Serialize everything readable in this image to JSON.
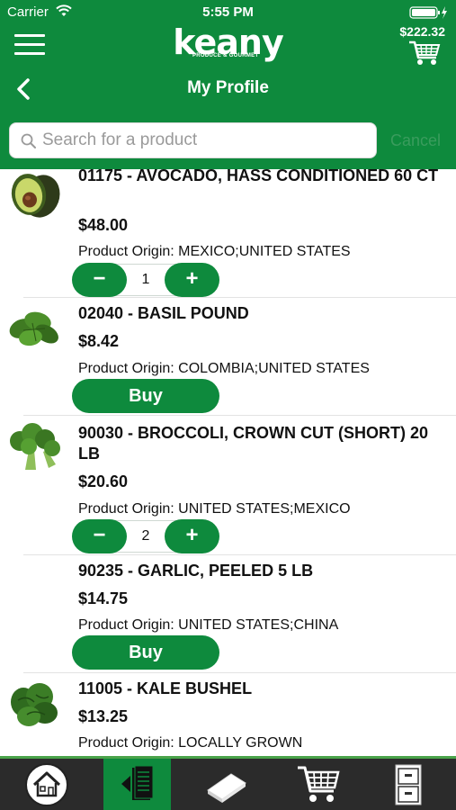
{
  "status_bar": {
    "carrier": "Carrier",
    "time": "5:55 PM"
  },
  "header": {
    "logo_text": "keany",
    "logo_subtext": "PRODUCE & GOURMET",
    "cart_total": "$222.32",
    "title": "My Profile"
  },
  "search": {
    "placeholder": "Search for a product",
    "value": "",
    "cancel_label": "Cancel"
  },
  "products": [
    {
      "name": "01175 - AVOCADO, HASS CONDITIONED 60 CT",
      "price": "$48.00",
      "origin": "Product Origin: MEXICO;UNITED STATES",
      "action": "stepper",
      "quantity": "1",
      "image": "avocado"
    },
    {
      "name": "02040 - BASIL POUND",
      "price": "$8.42",
      "origin": "Product Origin: COLOMBIA;UNITED STATES",
      "action": "buy",
      "buy_label": "Buy",
      "image": "basil"
    },
    {
      "name": "90030 - BROCCOLI, CROWN CUT (SHORT) 20 LB",
      "price": "$20.60",
      "origin": "Product Origin: UNITED STATES;MEXICO",
      "action": "stepper",
      "quantity": "2",
      "image": "broccoli"
    },
    {
      "name": "90235 - GARLIC, PEELED 5 LB",
      "price": "$14.75",
      "origin": "Product Origin: UNITED STATES;CHINA",
      "action": "buy",
      "buy_label": "Buy",
      "image": "none"
    },
    {
      "name": "11005 - KALE BUSHEL",
      "price": "$13.25",
      "origin": "Product Origin: LOCALLY GROWN",
      "action": "none",
      "image": "kale"
    }
  ],
  "stepper": {
    "minus_symbol": "−",
    "plus_symbol": "+"
  },
  "tab_bar": {
    "tabs": [
      {
        "icon": "home-icon",
        "active": false
      },
      {
        "icon": "order-list-icon",
        "active": true
      },
      {
        "icon": "catalog-book-icon",
        "active": false
      },
      {
        "icon": "shopping-cart-icon",
        "active": false
      },
      {
        "icon": "file-cabinet-icon",
        "active": false
      }
    ]
  },
  "colors": {
    "brand_green": "#0e8a3d",
    "tab_bar_bg": "#2b2b2b",
    "accent_line": "#4aa34a"
  }
}
